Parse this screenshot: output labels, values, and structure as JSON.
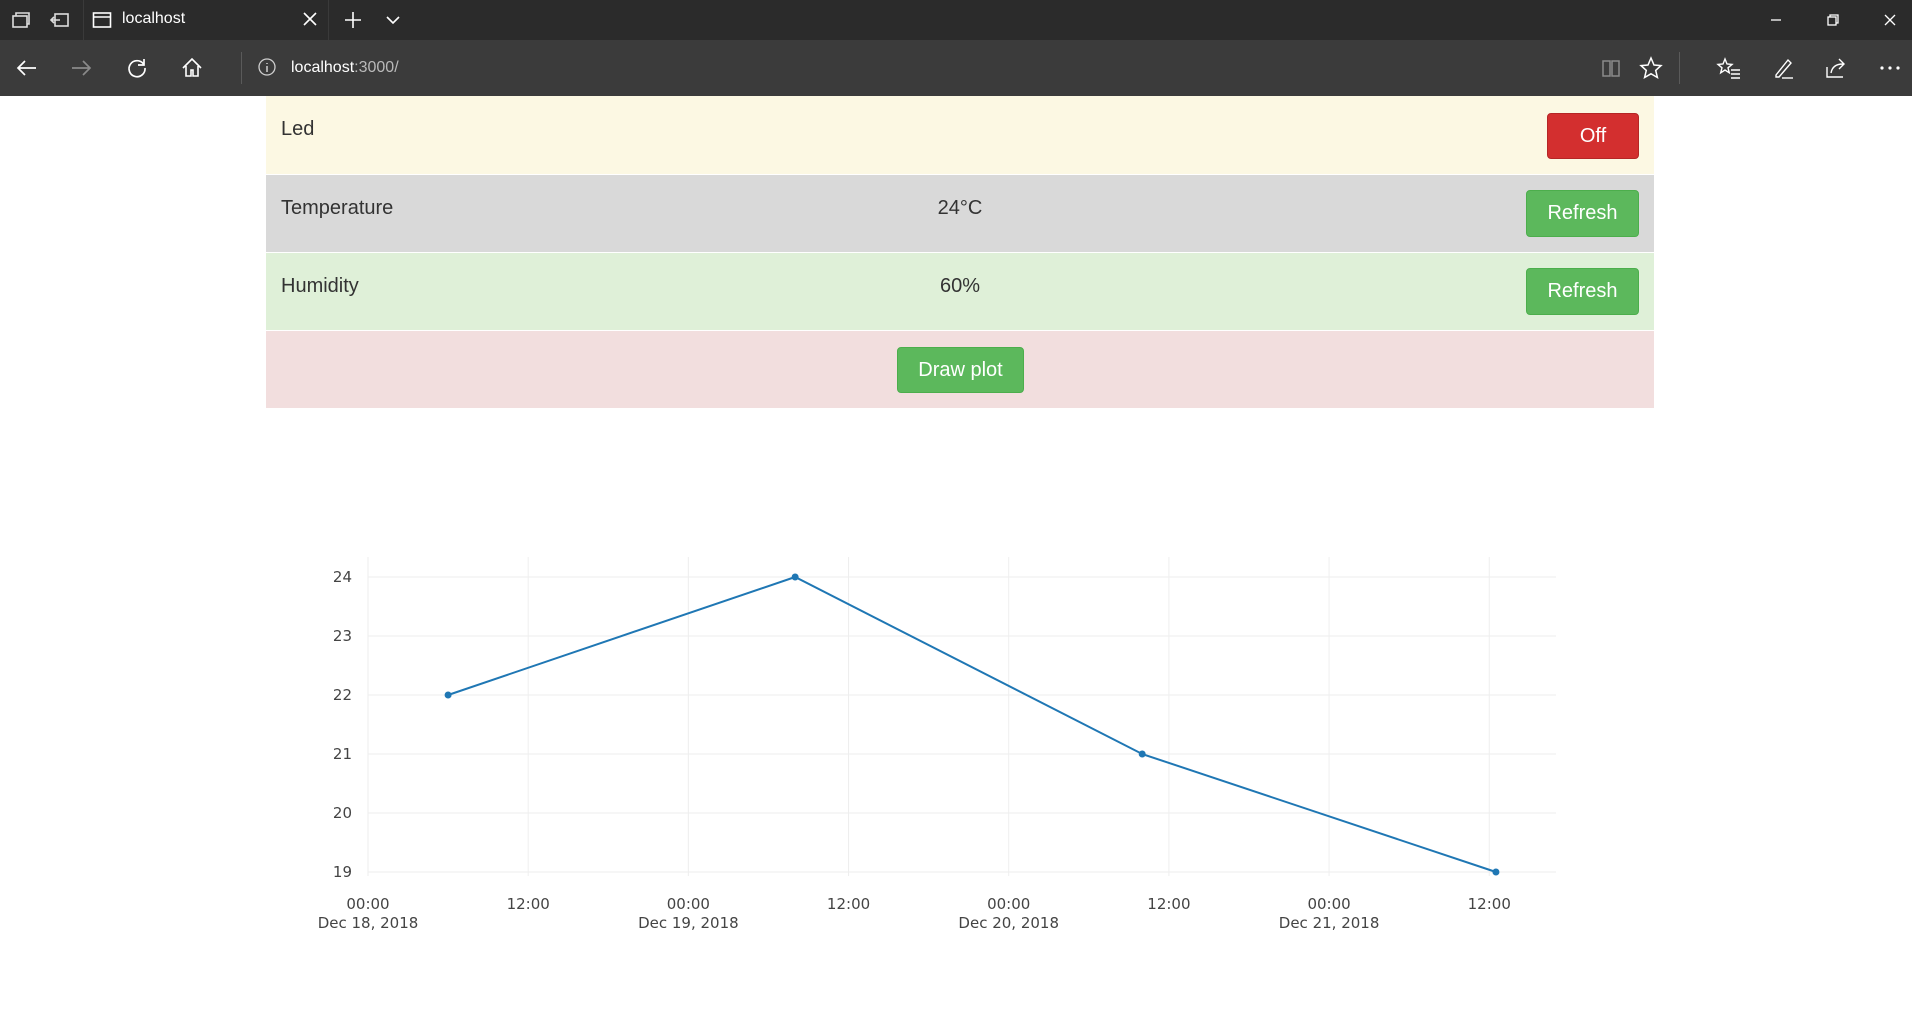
{
  "browser": {
    "tab_title": "localhost",
    "url_host": "localhost",
    "url_port": ":3000/"
  },
  "panel": {
    "led": {
      "label": "Led",
      "button": "Off"
    },
    "temperature": {
      "label": "Temperature",
      "value": "24°C",
      "button": "Refresh"
    },
    "humidity": {
      "label": "Humidity",
      "value": "60%",
      "button": "Refresh"
    },
    "plot": {
      "button": "Draw plot"
    }
  },
  "colors": {
    "led_row": "#fcf8e3",
    "temperature_row": "#d9d9d9",
    "humidity_row": "#dff0d8",
    "plot_row": "#f2dede",
    "off_button": "#d32f2f",
    "refresh_button": "#5cb85c",
    "series_line": "#1f77b4"
  },
  "chart_data": {
    "type": "line",
    "title": "",
    "xlabel": "",
    "ylabel": "",
    "xlim": [
      "2018-12-18 00:00",
      "2018-12-21 17:00"
    ],
    "ylim": [
      19,
      24
    ],
    "grid": true,
    "x": [
      "2018-12-18 06:00",
      "2018-12-19 08:00",
      "2018-12-20 10:00",
      "2018-12-21 12:30"
    ],
    "values": [
      22,
      24,
      21,
      19
    ],
    "y_ticks": [
      "19",
      "20",
      "21",
      "22",
      "23",
      "24"
    ],
    "x_ticks": [
      {
        "at": "2018-12-18 00:00",
        "time": "00:00",
        "date": "Dec 18, 2018"
      },
      {
        "at": "2018-12-18 12:00",
        "time": "12:00",
        "date": ""
      },
      {
        "at": "2018-12-19 00:00",
        "time": "00:00",
        "date": "Dec 19, 2018"
      },
      {
        "at": "2018-12-19 12:00",
        "time": "12:00",
        "date": ""
      },
      {
        "at": "2018-12-20 00:00",
        "time": "00:00",
        "date": "Dec 20, 2018"
      },
      {
        "at": "2018-12-20 12:00",
        "time": "12:00",
        "date": ""
      },
      {
        "at": "2018-12-21 00:00",
        "time": "00:00",
        "date": "Dec 21, 2018"
      },
      {
        "at": "2018-12-21 12:00",
        "time": "12:00",
        "date": ""
      }
    ]
  }
}
